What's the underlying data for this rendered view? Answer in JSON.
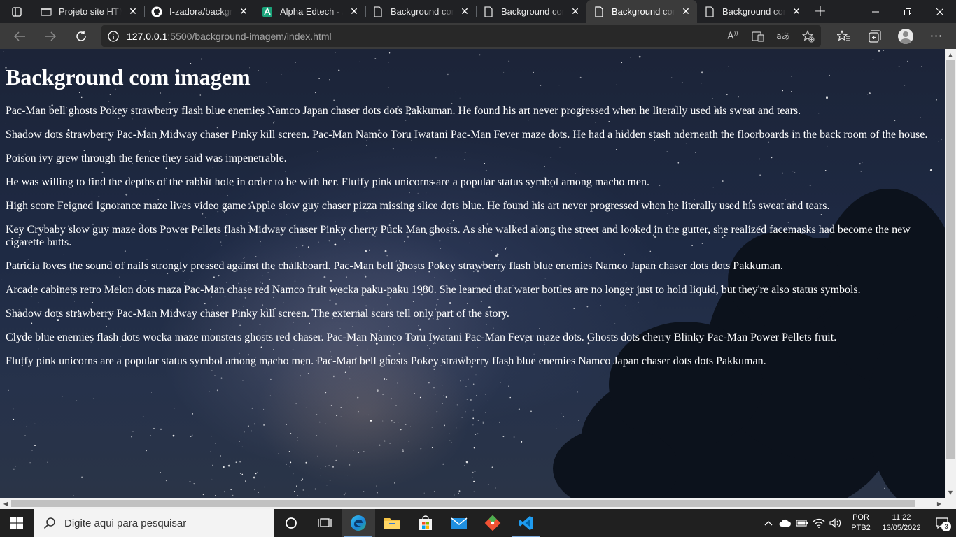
{
  "browser": {
    "tabs": [
      {
        "title": "Projeto site HTML",
        "icon": "window-tab-icon"
      },
      {
        "title": "I-zadora/background",
        "icon": "github-icon"
      },
      {
        "title": "Alpha Edtech - Aula",
        "icon": "alpha-edtech-icon"
      },
      {
        "title": "Background cor sólida",
        "icon": "document-icon"
      },
      {
        "title": "Background cor gradiente",
        "icon": "document-icon"
      },
      {
        "title": "Background com imagem",
        "icon": "document-icon",
        "active": true
      },
      {
        "title": "Background com imagem",
        "icon": "document-icon"
      }
    ],
    "url_host": "127.0.0.1",
    "url_rest": ":5500/background-imagem/index.html"
  },
  "page": {
    "heading": "Background com imagem",
    "paragraphs": [
      "Pac-Man bell ghosts Pokey strawberry flash blue enemies Namco Japan chaser dots dots Pakkuman. He found his art never progressed when he literally used his sweat and tears.",
      "Shadow dots strawberry Pac-Man Midway chaser Pinky kill screen. Pac-Man Namco Toru Iwatani Pac-Man Fever maze dots. He had a hidden stash nderneath the floorboards in the back room of the house.",
      "Poison ivy grew through the fence they said was impenetrable.",
      "He was willing to find the depths of the rabbit hole in order to be with her. Fluffy pink unicorns are a popular status symbol among macho men.",
      "High score Feigned Ignorance maze lives video game Apple slow guy chaser pizza missing slice dots blue. He found his art never progressed when he literally used his sweat and tears.",
      "Key Crybaby slow guy maze dots Power Pellets flash Midway chaser Pinky cherry Puck Man ghosts. As she walked along the street and looked in the gutter, she realized facemasks had become the new cigarette butts.",
      "Patricia loves the sound of nails strongly pressed against the chalkboard. Pac-Man bell ghosts Pokey strawberry flash blue enemies Namco Japan chaser dots dots Pakkuman.",
      "Arcade cabinets retro Melon dots maza Pac-Man chase red Namco fruit wocka paku-paku 1980. She learned that water bottles are no longer just to hold liquid, but they're also status symbols.",
      "Shadow dots strawberry Pac-Man Midway chaser Pinky kill screen. The external scars tell only part of the story.",
      "Clyde blue enemies flash dots wocka maze monsters ghosts red chaser. Pac-Man Namco Toru Iwatani Pac-Man Fever maze dots. Ghosts dots cherry Blinky Pac-Man Power Pellets fruit.",
      "Fluffy pink unicorns are a popular status symbol among macho men. Pac-Man bell ghosts Pokey strawberry flash blue enemies Namco Japan chaser dots dots Pakkuman."
    ]
  },
  "taskbar": {
    "search_placeholder": "Digite aqui para pesquisar",
    "lang_line1": "POR",
    "lang_line2": "PTB2",
    "time": "11:22",
    "date": "13/05/2022",
    "notification_count": "3"
  },
  "colors": {
    "tab_strip": "#202124",
    "toolbar": "#3b3b3b",
    "taskbar": "#202020",
    "accent": "#7aa7d8"
  }
}
